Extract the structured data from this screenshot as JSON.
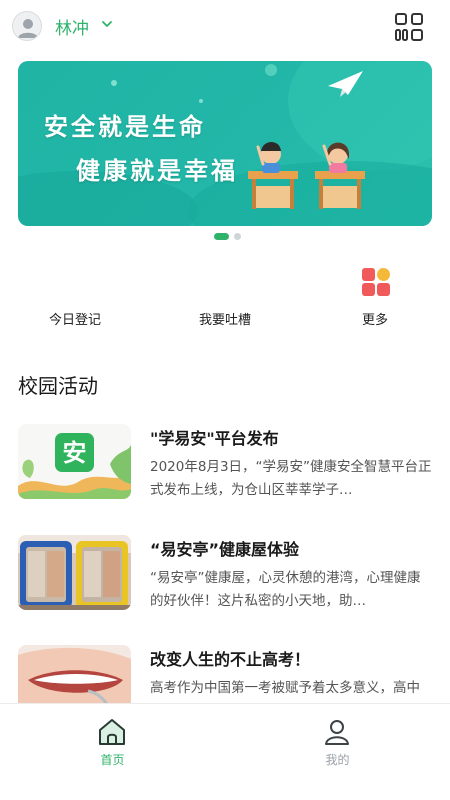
{
  "header": {
    "user_name": "林冲",
    "avatar_icon": "user-avatar-icon",
    "dropdown_icon": "chevron-down-icon",
    "scan_icon": "grid-scan-icon"
  },
  "banner": {
    "line1": "安全就是生命",
    "line2": "健康就是幸福",
    "slide_count": 2,
    "active_slide": 1
  },
  "quick_actions": [
    {
      "label": "今日登记",
      "icon": ""
    },
    {
      "label": "我要吐槽",
      "icon": ""
    },
    {
      "label": "更多",
      "icon": "more-apps-icon"
    }
  ],
  "section": {
    "title": "校园活动"
  },
  "articles": [
    {
      "title": "\"学易安\"平台发布",
      "desc": "2020年8月3日，“学易安”健康安全智慧平台正式发布上线，为仓山区莘莘学子…",
      "thumb_text": "安"
    },
    {
      "title": "“易安亭”健康屋体验",
      "desc": "“易安亭”健康屋，心灵休憩的港湾，心理健康的好伙伴！这片私密的小天地，助…"
    },
    {
      "title": "改变人生的不止高考！",
      "desc": "高考作为中国第一考被赋予着太多意义，高中初中学可以改变命运，然而，改变…"
    }
  ],
  "tabbar": {
    "tabs": [
      {
        "label": "首页",
        "icon": "home-icon",
        "active": true
      },
      {
        "label": "我的",
        "icon": "profile-icon",
        "active": false
      }
    ]
  },
  "colors": {
    "accent": "#2fb36b",
    "banner_bg": "#22b7a8",
    "tab_inactive": "#9aa0a6",
    "more_icon_red": "#f05a5a",
    "more_icon_yellow": "#f5b93a"
  }
}
